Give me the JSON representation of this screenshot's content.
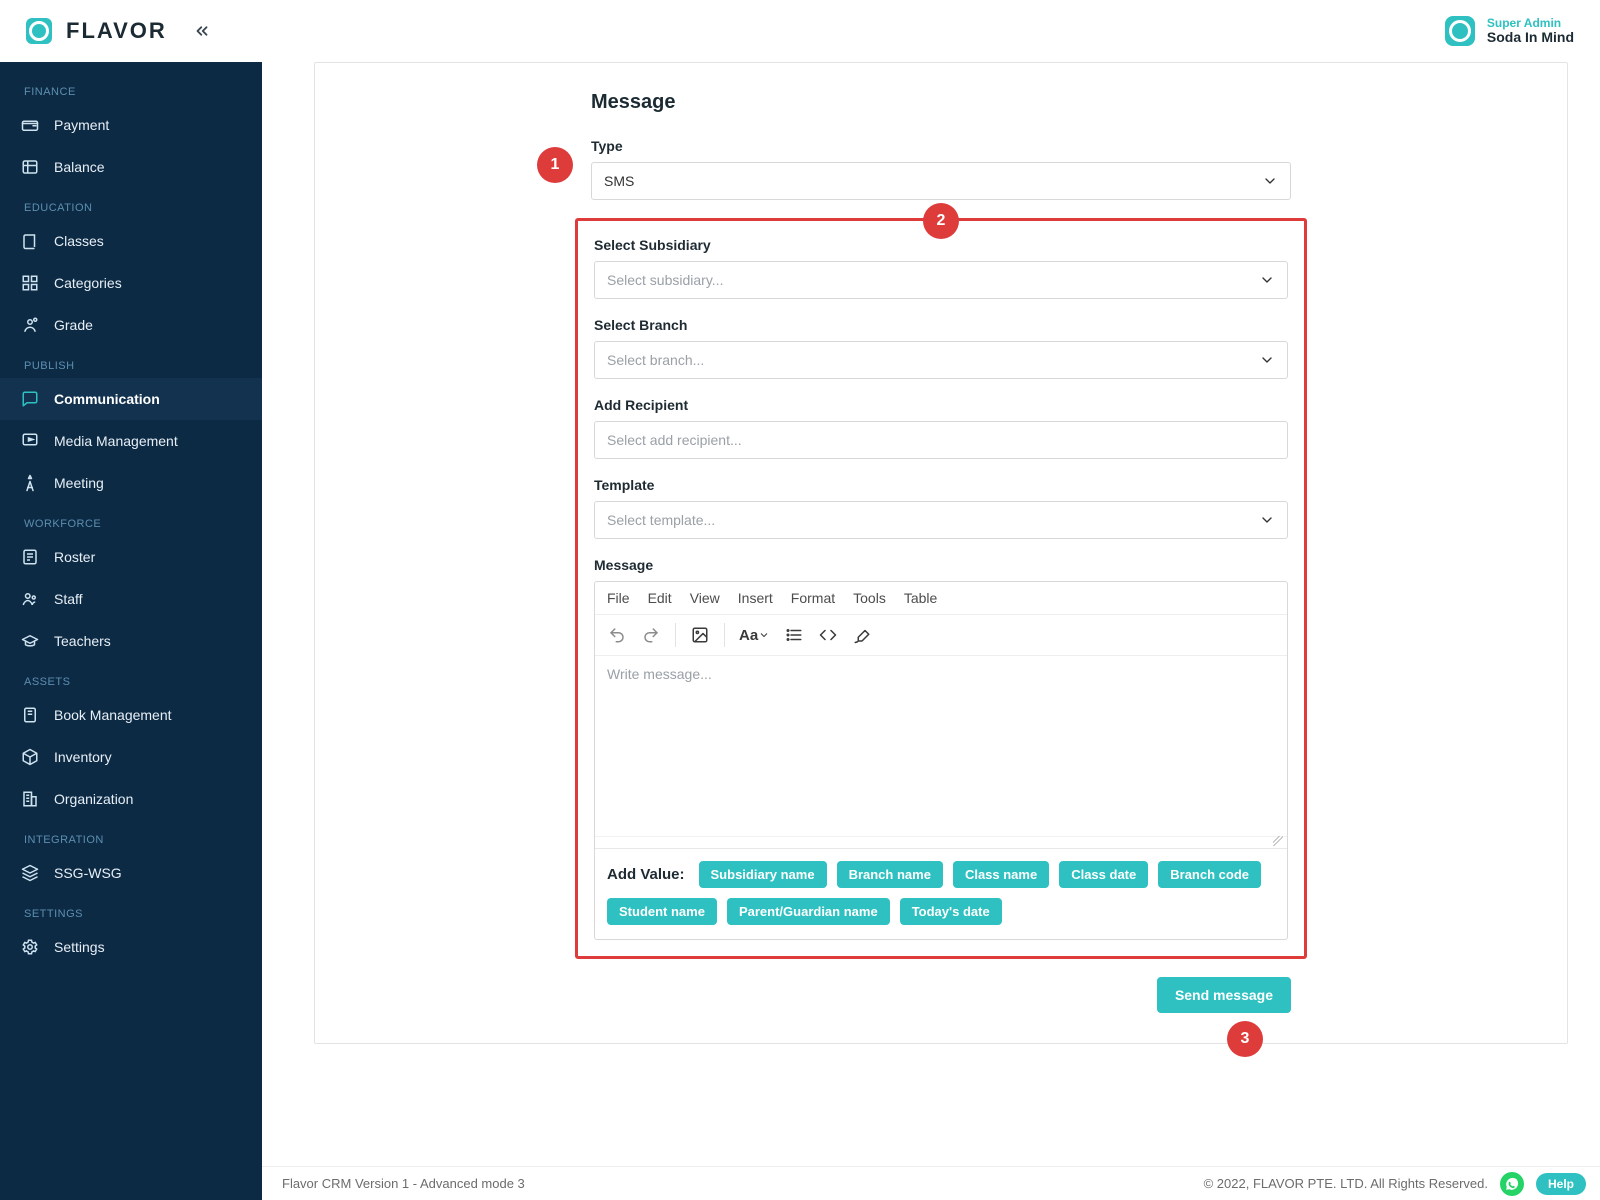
{
  "brand": "FLAVOR",
  "user": {
    "role": "Super Admin",
    "name": "Soda In Mind"
  },
  "sidebar": {
    "sections": [
      {
        "title": "FINANCE",
        "items": [
          {
            "icon": "wallet-icon",
            "label": "Payment"
          },
          {
            "icon": "ledger-icon",
            "label": "Balance"
          }
        ]
      },
      {
        "title": "EDUCATION",
        "items": [
          {
            "icon": "book-icon",
            "label": "Classes"
          },
          {
            "icon": "grid-icon",
            "label": "Categories"
          },
          {
            "icon": "grade-icon",
            "label": "Grade"
          }
        ]
      },
      {
        "title": "PUBLISH",
        "items": [
          {
            "icon": "chat-icon",
            "label": "Communication",
            "active": true
          },
          {
            "icon": "media-icon",
            "label": "Media Management"
          },
          {
            "icon": "meeting-icon",
            "label": "Meeting"
          }
        ]
      },
      {
        "title": "WORKFORCE",
        "items": [
          {
            "icon": "roster-icon",
            "label": "Roster"
          },
          {
            "icon": "people-icon",
            "label": "Staff"
          },
          {
            "icon": "teacher-icon",
            "label": "Teachers"
          }
        ]
      },
      {
        "title": "ASSETS",
        "items": [
          {
            "icon": "bookmgmt-icon",
            "label": "Book Management"
          },
          {
            "icon": "inventory-icon",
            "label": "Inventory"
          },
          {
            "icon": "org-icon",
            "label": "Organization"
          }
        ]
      },
      {
        "title": "INTEGRATION",
        "items": [
          {
            "icon": "stack-icon",
            "label": "SSG-WSG"
          }
        ]
      },
      {
        "title": "SETTINGS",
        "items": [
          {
            "icon": "gear-icon",
            "label": "Settings"
          }
        ]
      }
    ]
  },
  "form": {
    "title": "Message",
    "type_label": "Type",
    "type_value": "SMS",
    "subsidiary_label": "Select Subsidiary",
    "subsidiary_placeholder": "Select subsidiary...",
    "branch_label": "Select Branch",
    "branch_placeholder": "Select branch...",
    "recipient_label": "Add Recipient",
    "recipient_placeholder": "Select add recipient...",
    "template_label": "Template",
    "template_placeholder": "Select template...",
    "message_label": "Message",
    "message_placeholder": "Write message...",
    "add_value_label": "Add Value:",
    "chips": [
      "Subsidiary name",
      "Branch name",
      "Class name",
      "Class date",
      "Branch code",
      "Student name",
      "Parent/Guardian name",
      "Today's date"
    ],
    "send_label": "Send message"
  },
  "editor_menu": [
    "File",
    "Edit",
    "View",
    "Insert",
    "Format",
    "Tools",
    "Table"
  ],
  "callouts": {
    "one": "1",
    "two": "2",
    "three": "3"
  },
  "footer": {
    "left": "Flavor CRM Version 1 - Advanced mode 3",
    "right": "© 2022, FLAVOR PTE. LTD. All Rights Reserved.",
    "help": "Help"
  }
}
